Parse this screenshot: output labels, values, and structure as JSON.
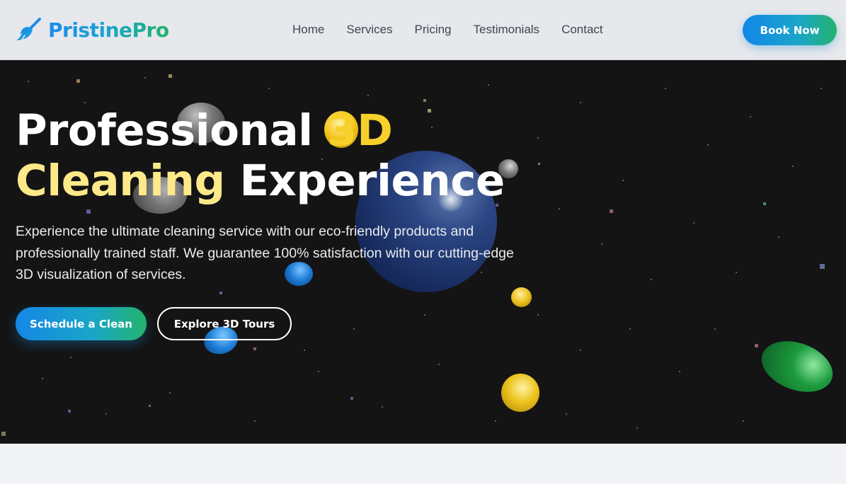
{
  "brand": {
    "name": "PristinePro",
    "icon": "broom-icon"
  },
  "nav": {
    "links": [
      "Home",
      "Services",
      "Pricing",
      "Testimonials",
      "Contact"
    ],
    "cta": "Book Now"
  },
  "hero": {
    "title_part1": "Professional ",
    "title_accent1": "3D",
    "title_accent2": "Cleaning",
    "title_part2": " Experience",
    "subtitle": "Experience the ultimate cleaning service with our eco-friendly products and professionally trained staff. We guarantee 100% satisfaction with our cutting-edge 3D visualization of services.",
    "primary_cta": "Schedule a Clean",
    "secondary_cta": "Explore 3D Tours"
  },
  "colors": {
    "hero_bg": "#141414",
    "accent_yellow": "#f7d02b",
    "gradient_blue": "#1287e8",
    "gradient_green": "#25b36d"
  }
}
